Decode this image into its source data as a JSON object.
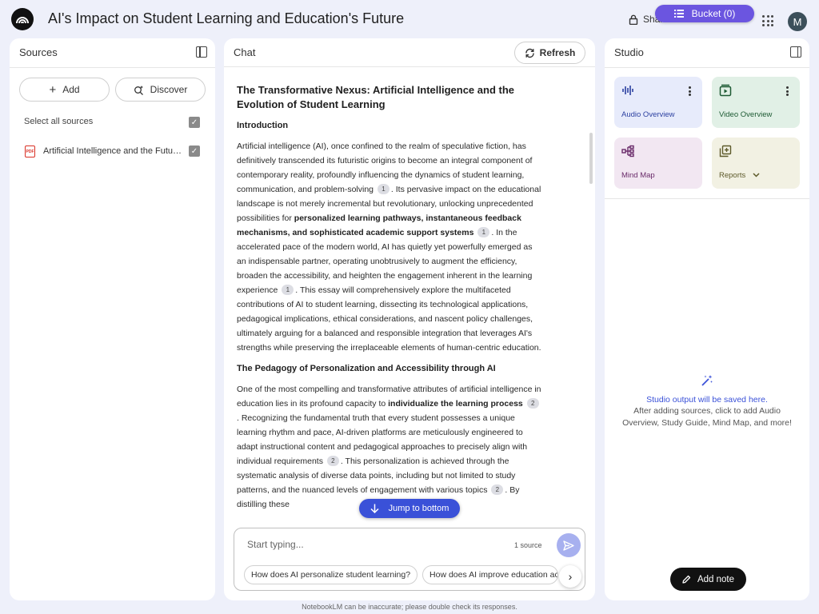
{
  "header": {
    "title": "AI's Impact on Student Learning and Education's Future",
    "share_label": "Share",
    "bucket_label": "Bucket (0)",
    "avatar_initial": "M"
  },
  "sources": {
    "title": "Sources",
    "add_label": "Add",
    "discover_label": "Discover",
    "select_all_label": "Select all sources",
    "items": [
      {
        "name": "Artificial Intelligence and the Future of Student Learning",
        "type": "PDF",
        "checked": true
      }
    ]
  },
  "chat": {
    "title": "Chat",
    "refresh_label": "Refresh",
    "doc_title": "The Transformative Nexus: Artificial Intelligence and the Evolution of Student Learning",
    "sections": [
      {
        "heading": "Introduction"
      },
      {
        "heading": "The Pedagogy of Personalization and Accessibility through AI"
      }
    ],
    "jump_label": "Jump to bottom",
    "input_placeholder": "Start typing...",
    "source_count": "1 source",
    "suggestions": [
      "How does AI personalize student learning?",
      "How does AI improve education accessibility?"
    ]
  },
  "studio": {
    "title": "Studio",
    "tiles": [
      {
        "label": "Audio Overview"
      },
      {
        "label": "Video Overview"
      },
      {
        "label": "Mind Map"
      },
      {
        "label": "Reports"
      }
    ],
    "empty_title": "Studio output will be saved here.",
    "empty_subtitle": "After adding sources, click to add Audio Overview, Study Guide, Mind Map, and more!",
    "add_note_label": "Add note"
  },
  "footer": "NotebookLM can be inaccurate; please double check its responses.",
  "colors": {
    "accent": "#3a51d8",
    "bucket": "#6b55e0",
    "background": "#eef0fa"
  }
}
